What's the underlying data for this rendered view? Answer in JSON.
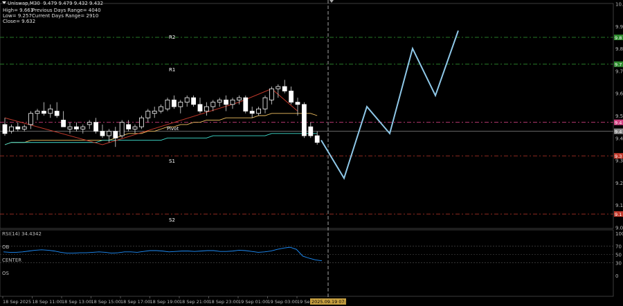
{
  "info": {
    "symbol_line": "Uniswap,M30  9.479 9.479 9.432 9.432",
    "high_line": "High= 9.661",
    "prev_range": "Previous Days Range= 4040",
    "low_line": "Low= 9.257",
    "cur_range": "Current Days Range= 2910",
    "close_line": "Close= 9.632"
  },
  "levels": {
    "r2": "R2",
    "r1": "R1",
    "pivot": "Pivot",
    "s1": "S1",
    "s2": "S2"
  },
  "rsi": {
    "title": "RSI(14) 34.4342",
    "ob": "OB",
    "center": "CENTER",
    "os": "OS",
    "ticks": [
      "100",
      "70",
      "50",
      "30",
      "0"
    ]
  },
  "price_ticks": [
    "10.",
    "9.9",
    "9.8",
    "9.7",
    "9.6",
    "9.5",
    "9.4",
    "9.3",
    "9.2",
    "9.1",
    "9.0"
  ],
  "price_tags": [
    "9.8",
    "9.7",
    "9.4",
    "9.4",
    "9.3",
    "9.1"
  ],
  "time_ticks": [
    "18 Sep 2025",
    "18 Sep 11:00",
    "18 Sep 13:00",
    "18 Sep 15:00",
    "18 Sep 17:00",
    "18 Sep 19:00",
    "18 Sep 21:00",
    "18 Sep 23:00",
    "19 Sep 01:00",
    "19 Sep 03:00",
    "19 Se"
  ],
  "cursor_time": "2025.09.19 07:00",
  "chart_data": {
    "type": "candlestick",
    "ohlc": [
      [
        9.46,
        9.49,
        9.41,
        9.42
      ],
      [
        9.43,
        9.46,
        9.42,
        9.45
      ],
      [
        9.45,
        9.47,
        9.43,
        9.44
      ],
      [
        9.44,
        9.46,
        9.43,
        9.45
      ],
      [
        9.46,
        9.52,
        9.44,
        9.51
      ],
      [
        9.51,
        9.53,
        9.48,
        9.52
      ],
      [
        9.52,
        9.56,
        9.5,
        9.51
      ],
      [
        9.51,
        9.55,
        9.49,
        9.53
      ],
      [
        9.52,
        9.56,
        9.49,
        9.5
      ],
      [
        9.48,
        9.52,
        9.45,
        9.45
      ],
      [
        9.44,
        9.47,
        9.42,
        9.45
      ],
      [
        9.45,
        9.47,
        9.43,
        9.44
      ],
      [
        9.44,
        9.46,
        9.42,
        9.45
      ],
      [
        9.46,
        9.48,
        9.44,
        9.47
      ],
      [
        9.47,
        9.49,
        9.42,
        9.43
      ],
      [
        9.43,
        9.46,
        9.4,
        9.41
      ],
      [
        9.41,
        9.44,
        9.38,
        9.43
      ],
      [
        9.43,
        9.45,
        9.36,
        9.4
      ],
      [
        9.41,
        9.48,
        9.4,
        9.47
      ],
      [
        9.46,
        9.48,
        9.43,
        9.44
      ],
      [
        9.44,
        9.46,
        9.42,
        9.45
      ],
      [
        9.45,
        9.5,
        9.44,
        9.49
      ],
      [
        9.49,
        9.53,
        9.47,
        9.52
      ],
      [
        9.51,
        9.54,
        9.49,
        9.52
      ],
      [
        9.52,
        9.55,
        9.51,
        9.54
      ],
      [
        9.53,
        9.58,
        9.52,
        9.57
      ],
      [
        9.57,
        9.59,
        9.53,
        9.54
      ],
      [
        9.54,
        9.57,
        9.51,
        9.56
      ],
      [
        9.56,
        9.59,
        9.54,
        9.58
      ],
      [
        9.58,
        9.59,
        9.54,
        9.55
      ],
      [
        9.55,
        9.58,
        9.51,
        9.52
      ],
      [
        9.52,
        9.56,
        9.5,
        9.54
      ],
      [
        9.54,
        9.57,
        9.52,
        9.56
      ],
      [
        9.56,
        9.58,
        9.54,
        9.57
      ],
      [
        9.57,
        9.59,
        9.52,
        9.55
      ],
      [
        9.55,
        9.58,
        9.53,
        9.57
      ],
      [
        9.57,
        9.59,
        9.55,
        9.58
      ],
      [
        9.58,
        9.59,
        9.51,
        9.52
      ],
      [
        9.52,
        9.54,
        9.49,
        9.51
      ],
      [
        9.51,
        9.54,
        9.5,
        9.53
      ],
      [
        9.53,
        9.59,
        9.51,
        9.58
      ],
      [
        9.57,
        9.63,
        9.55,
        9.62
      ],
      [
        9.62,
        9.64,
        9.58,
        9.63
      ],
      [
        9.63,
        9.66,
        9.6,
        9.61
      ],
      [
        9.61,
        9.63,
        9.55,
        9.56
      ],
      [
        9.56,
        9.58,
        9.5,
        9.55
      ],
      [
        9.55,
        9.56,
        9.4,
        9.41
      ],
      [
        9.45,
        9.47,
        9.4,
        9.41
      ],
      [
        9.41,
        9.43,
        9.37,
        9.38
      ]
    ],
    "ma_fast": [
      9.37,
      9.38,
      9.38,
      9.38,
      9.39,
      9.39,
      9.39,
      9.39,
      9.39,
      9.39,
      9.39,
      9.39,
      9.39,
      9.39,
      9.39,
      9.39,
      9.39,
      9.4,
      9.41,
      9.42,
      9.42,
      9.42,
      9.43,
      9.43,
      9.44,
      9.45,
      9.45,
      9.46,
      9.46,
      9.47,
      9.47,
      9.48,
      9.48,
      9.48,
      9.49,
      9.49,
      9.49,
      9.49,
      9.49,
      9.5,
      9.5,
      9.51,
      9.51,
      9.51,
      9.51,
      9.51,
      9.51,
      9.51,
      9.5
    ],
    "ma_slow": [
      9.37,
      9.38,
      9.38,
      9.38,
      9.38,
      9.38,
      9.38,
      9.38,
      9.38,
      9.38,
      9.38,
      9.38,
      9.38,
      9.38,
      9.38,
      9.39,
      9.39,
      9.39,
      9.39,
      9.39,
      9.39,
      9.39,
      9.39,
      9.39,
      9.39,
      9.4,
      9.4,
      9.4,
      9.4,
      9.4,
      9.4,
      9.4,
      9.41,
      9.41,
      9.41,
      9.41,
      9.41,
      9.41,
      9.41,
      9.41,
      9.41,
      9.42,
      9.42,
      9.42,
      9.42,
      9.42,
      9.42,
      9.42,
      9.42
    ],
    "zigzag": [
      [
        0,
        9.49
      ],
      [
        15,
        9.37
      ],
      [
        36,
        9.56
      ],
      [
        41,
        9.62
      ],
      [
        45,
        9.52
      ]
    ],
    "projection": [
      9.39,
      9.22,
      9.54,
      9.42,
      9.8,
      9.59,
      9.88
    ],
    "levels": {
      "r2": 9.85,
      "r1": 9.73,
      "pivot": 9.47,
      "s1": 9.32,
      "s2": 9.06
    },
    "last_price": 9.43,
    "rsi": [
      56,
      55,
      55,
      56,
      58,
      60,
      61,
      60,
      58,
      55,
      53,
      53,
      54,
      54,
      55,
      56,
      55,
      53,
      54,
      56,
      56,
      55,
      57,
      59,
      59,
      58,
      56,
      57,
      58,
      58,
      57,
      58,
      59,
      59,
      57,
      57,
      58,
      60,
      59,
      57,
      55,
      56,
      58,
      62,
      65,
      67,
      62,
      46,
      41,
      37,
      35
    ],
    "ylim": [
      9.0,
      10.0
    ]
  },
  "colors": {
    "bull": "#ffffff",
    "bear": "#ffffff",
    "zigzag": "#c0392b",
    "ma_fast": "#f0c060",
    "ma_slow": "#40e0d0",
    "projection": "#8fc8e8",
    "r_line": "#2e8b2e",
    "s_line": "#c0392b",
    "pivot_line": "#d04080",
    "rsi_line": "#1e90ff"
  }
}
